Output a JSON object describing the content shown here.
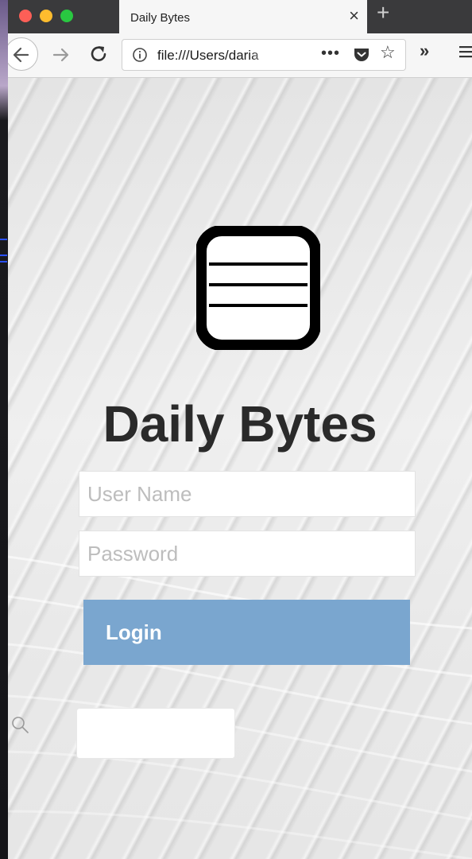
{
  "browser": {
    "tab_title": "Daily Bytes",
    "tab_close": "×",
    "new_tab": "+",
    "url": "file:///Users/daria",
    "more": "•••",
    "star": "☆",
    "overflow": "»"
  },
  "app": {
    "title": "Daily Bytes",
    "login": {
      "username_placeholder": "User Name",
      "password_placeholder": "Password",
      "button_label": "Login"
    },
    "search": {
      "placeholder": ""
    }
  },
  "colors": {
    "login_button": "#7aa6cf",
    "title_text": "#2a2a2a"
  },
  "icons": {
    "logo": "database-icon",
    "search": "search-icon"
  }
}
